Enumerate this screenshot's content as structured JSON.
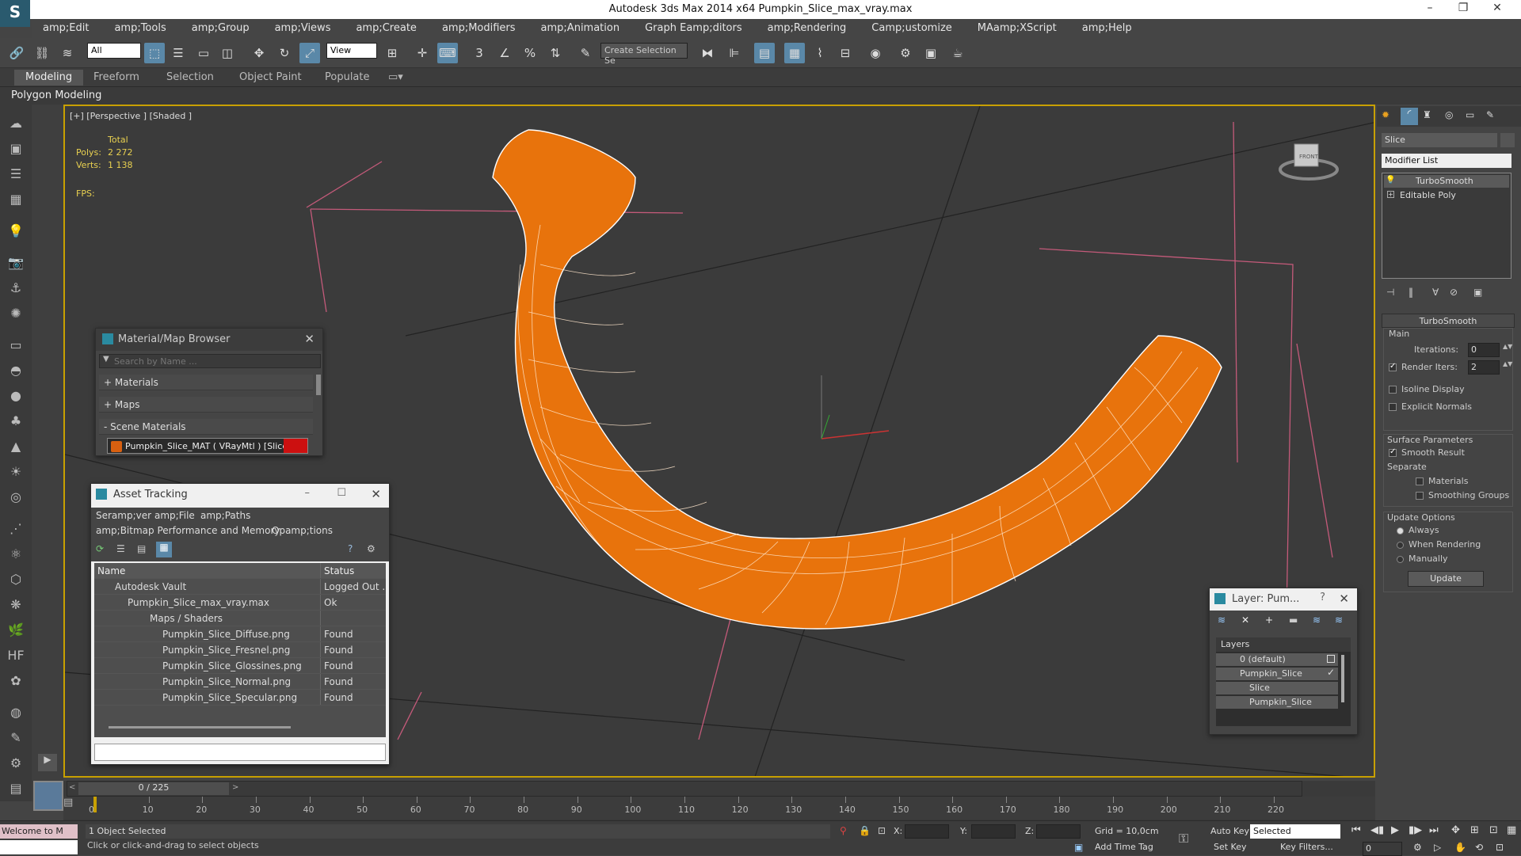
{
  "window": {
    "title": "Autodesk 3ds Max  2014 x64     Pumpkin_Slice_max_vray.max"
  },
  "menu": [
    "amp;Edit",
    "amp;Tools",
    "amp;Group",
    "amp;Views",
    "amp;Create",
    "amp;Modifiers",
    "amp;Animation",
    "Graph Eamp;ditors",
    "amp;Rendering",
    "Camp;ustomize",
    "MAamp;XScript",
    "amp;Help"
  ],
  "toolbar": {
    "filter_value": "All",
    "ref_coord_value": "View",
    "selection_set_placeholder": "Create Selection Se"
  },
  "ribbon": {
    "tabs": [
      "Modeling",
      "Freeform",
      "Selection",
      "Object Paint",
      "Populate"
    ],
    "subtitle": "Polygon Modeling"
  },
  "viewport": {
    "label": "[+] [Perspective ] [Shaded ]",
    "stats": {
      "total_label": "Total",
      "polys_label": "Polys:",
      "polys_value": "2 272",
      "verts_label": "Verts:",
      "verts_value": "1 138",
      "fps_label": "FPS:"
    },
    "viewcube_label": "FRONT"
  },
  "material_browser": {
    "title": "Material/Map Browser",
    "search_placeholder": "Search by Name ...",
    "groups": [
      "+ Materials",
      "+ Maps",
      "- Scene Materials"
    ],
    "item": "Pumpkin_Slice_MAT  ( VRayMtl )  [Slice]"
  },
  "asset_tracking": {
    "title": "Asset Tracking",
    "menu1": [
      "Seramp;ver",
      "amp;File",
      "amp;Paths"
    ],
    "menu2": [
      "amp;Bitmap Performance and Memory",
      "Opamp;tions"
    ],
    "columns": [
      "Name",
      "Status"
    ],
    "rows": [
      {
        "name": "Autodesk Vault",
        "status": "Logged Out ..."
      },
      {
        "name": "Pumpkin_Slice_max_vray.max",
        "status": "Ok"
      },
      {
        "name": "Maps / Shaders",
        "status": ""
      },
      {
        "name": "Pumpkin_Slice_Diffuse.png",
        "status": "Found"
      },
      {
        "name": "Pumpkin_Slice_Fresnel.png",
        "status": "Found"
      },
      {
        "name": "Pumpkin_Slice_Glossines.png",
        "status": "Found"
      },
      {
        "name": "Pumpkin_Slice_Normal.png",
        "status": "Found"
      },
      {
        "name": "Pumpkin_Slice_Specular.png",
        "status": "Found"
      }
    ]
  },
  "layer_panel": {
    "title": "Layer: Pum...",
    "header": "Layers",
    "items": [
      "0 (default)",
      "Pumpkin_Slice",
      "Slice",
      "Pumpkin_Slice"
    ]
  },
  "command_panel": {
    "object_name": "Slice",
    "modifier_list": "Modifier List",
    "stack": [
      "TurboSmooth",
      "Editable Poly"
    ],
    "rollout_title": "TurboSmooth",
    "main_label": "Main",
    "iterations_label": "Iterations:",
    "iterations_value": "0",
    "render_iters_label": "Render Iters:",
    "render_iters_value": "2",
    "isoline_label": "Isoline Display",
    "explicit_normals_label": "Explicit Normals",
    "surface_params_label": "Surface Parameters",
    "smooth_result_label": "Smooth Result",
    "separate_label": "Separate",
    "materials_label": "Materials",
    "smoothing_groups_label": "Smoothing Groups",
    "update_options_label": "Update Options",
    "always_label": "Always",
    "when_rendering_label": "When Rendering",
    "manually_label": "Manually",
    "update_button": "Update"
  },
  "timeline": {
    "frame_counter": "0 / 225",
    "ticks": [
      "0",
      "10",
      "20",
      "30",
      "40",
      "50",
      "60",
      "70",
      "80",
      "90",
      "100",
      "110",
      "120",
      "130",
      "140",
      "150",
      "160",
      "170",
      "180",
      "190",
      "200",
      "210",
      "220"
    ]
  },
  "status": {
    "welcome": "Welcome to M",
    "selected": "1 Object Selected",
    "hint": "Click or click-and-drag to select objects",
    "x_label": "X:",
    "y_label": "Y:",
    "z_label": "Z:",
    "grid": "Grid = 10,0cm",
    "add_time_tag": "Add Time Tag",
    "auto_key": "Auto Key",
    "auto_key_value": "Selected",
    "set_key": "Set Key",
    "key_filters": "Key Filters...",
    "frame_value": "0"
  },
  "colors": {
    "accent": "#5a88a8",
    "mesh": "#e8730c",
    "viewport_bg": "#3b3b3b",
    "viewport_border": "#c8a000"
  }
}
